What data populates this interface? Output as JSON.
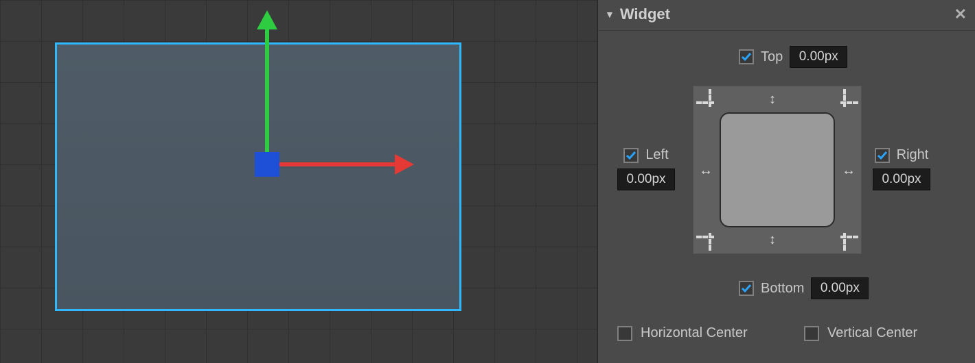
{
  "panel": {
    "title": "Widget",
    "top": {
      "label": "Top",
      "checked": true,
      "value": "0.00px"
    },
    "bottom": {
      "label": "Bottom",
      "checked": true,
      "value": "0.00px"
    },
    "left": {
      "label": "Left",
      "checked": true,
      "value": "0.00px"
    },
    "right": {
      "label": "Right",
      "checked": true,
      "value": "0.00px"
    },
    "hcenter": {
      "label": "Horizontal Center",
      "checked": false
    },
    "vcenter": {
      "label": "Vertical Center",
      "checked": false
    }
  }
}
